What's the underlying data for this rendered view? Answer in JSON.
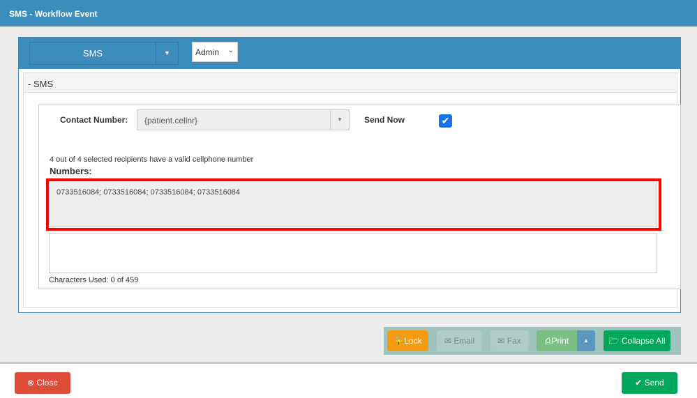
{
  "window": {
    "title": "SMS - Workflow Event"
  },
  "header": {
    "type_button": "SMS",
    "type_caret": "▼",
    "role_select": "Admin"
  },
  "section": {
    "title": "- SMS"
  },
  "form": {
    "contact_label": "Contact Number:",
    "contact_value": "{patient.cellnr}",
    "send_now_label": "Send Now",
    "send_now_checked": true,
    "recipients_note": "4 out of 4 selected recipients have a valid cellphone number",
    "numbers_label": "Numbers:",
    "numbers_value": "0733516084; 0733516084; 0733516084; 0733516084",
    "message_value": "",
    "chars_used": "Characters Used: 0 of 459"
  },
  "toolbar": {
    "lock": "Lock",
    "email": "Email",
    "fax": "Fax",
    "print": "Print",
    "collapse": "Collapse All"
  },
  "footer": {
    "close": "Close",
    "send": "Send"
  }
}
